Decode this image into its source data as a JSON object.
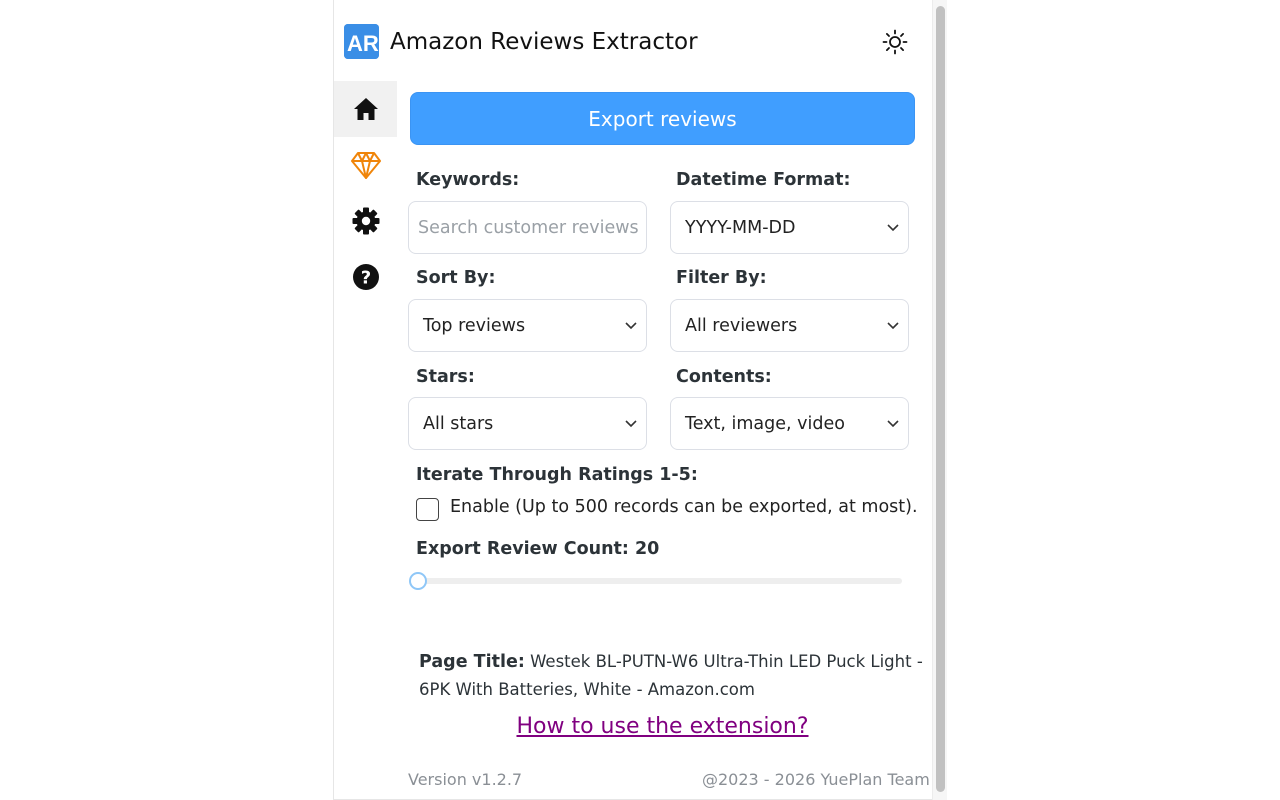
{
  "header": {
    "logo_text": "AR",
    "title": "Amazon Reviews Extractor",
    "theme_icon": "sun-icon"
  },
  "sidebar": {
    "items": [
      {
        "name": "home",
        "icon": "home-icon",
        "active": true
      },
      {
        "name": "pro",
        "icon": "diamond-icon",
        "color": "#f0850a"
      },
      {
        "name": "settings",
        "icon": "gear-icon"
      },
      {
        "name": "help",
        "icon": "question-circle-icon"
      }
    ]
  },
  "main": {
    "export_button": "Export reviews",
    "keywords": {
      "label": "Keywords:",
      "placeholder": "Search customer reviews",
      "value": ""
    },
    "datetime_format": {
      "label": "Datetime Format:",
      "value": "YYYY-MM-DD"
    },
    "sort_by": {
      "label": "Sort By:",
      "value": "Top reviews"
    },
    "filter_by": {
      "label": "Filter By:",
      "value": "All reviewers"
    },
    "stars": {
      "label": "Stars:",
      "value": "All stars"
    },
    "contents": {
      "label": "Contents:",
      "value": "Text, image, video"
    },
    "iterate": {
      "label": "Iterate Through Ratings 1-5:",
      "checkbox_label": "Enable (Up to 500 records can be exported, at most).",
      "checked": false
    },
    "export_count": {
      "label": "Export Review Count: 20",
      "value": 20,
      "slider_fraction": 0.0
    },
    "page_title": {
      "label": "Page Title:",
      "value": "Westek BL-PUTN-W6 Ultra-Thin LED Puck Light - 6PK With Batteries, White - Amazon.com"
    },
    "howto_link": "How to use the extension?"
  },
  "footer": {
    "version": "Version v1.2.7",
    "copyright": "@2023 - 2026 YuePlan Team"
  },
  "colors": {
    "accent": "#409eff",
    "link": "#800080",
    "pro": "#f0850a",
    "logo": "#3a8ee6"
  }
}
